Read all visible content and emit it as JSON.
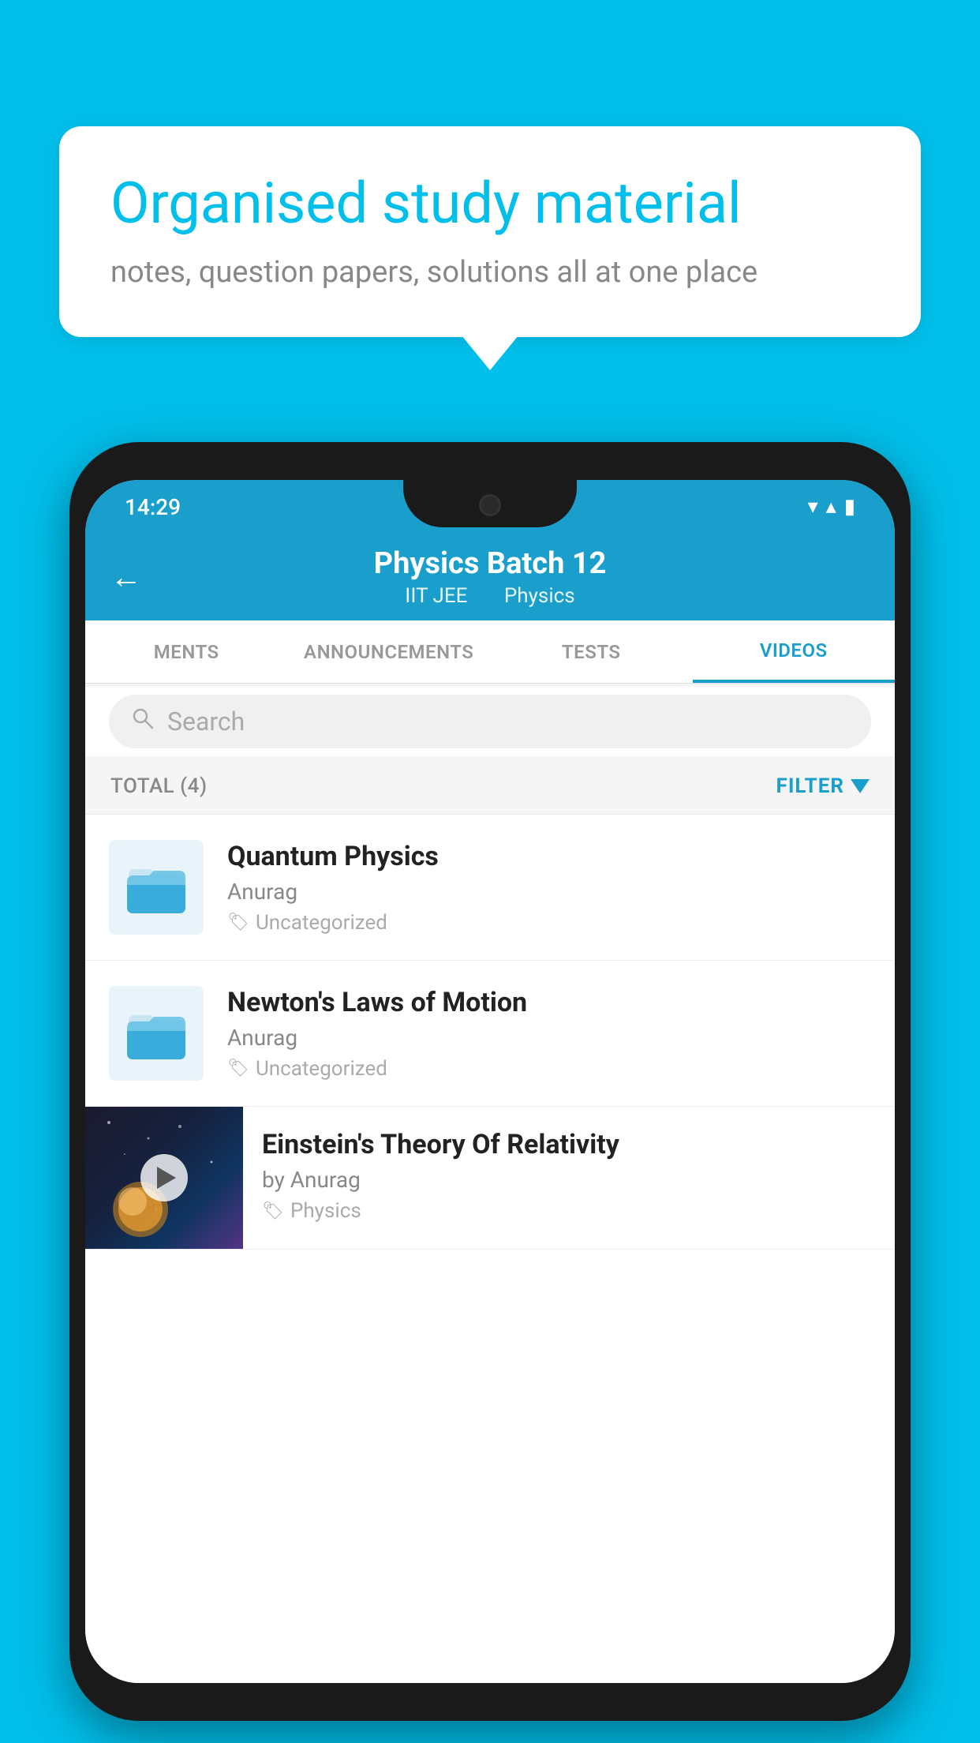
{
  "background_color": "#00BFEA",
  "bubble": {
    "title": "Organised study material",
    "subtitle": "notes, question papers, solutions all at one place"
  },
  "status_bar": {
    "time": "14:29",
    "wifi": "▼",
    "signal": "▲",
    "battery": "▮"
  },
  "header": {
    "title": "Physics Batch 12",
    "subtitle_left": "IIT JEE",
    "subtitle_right": "Physics",
    "back_arrow": "←"
  },
  "tabs": [
    {
      "label": "MENTS",
      "active": false
    },
    {
      "label": "ANNOUNCEMENTS",
      "active": false
    },
    {
      "label": "TESTS",
      "active": false
    },
    {
      "label": "VIDEOS",
      "active": true
    }
  ],
  "search": {
    "placeholder": "Search"
  },
  "filter": {
    "total_label": "TOTAL (4)",
    "filter_label": "FILTER"
  },
  "videos": [
    {
      "id": 1,
      "title": "Quantum Physics",
      "author": "Anurag",
      "tag": "Uncategorized",
      "has_thumb": false
    },
    {
      "id": 2,
      "title": "Newton's Laws of Motion",
      "author": "Anurag",
      "tag": "Uncategorized",
      "has_thumb": false
    },
    {
      "id": 3,
      "title": "Einstein's Theory Of Relativity",
      "author": "by Anurag",
      "tag": "Physics",
      "has_thumb": true
    }
  ]
}
